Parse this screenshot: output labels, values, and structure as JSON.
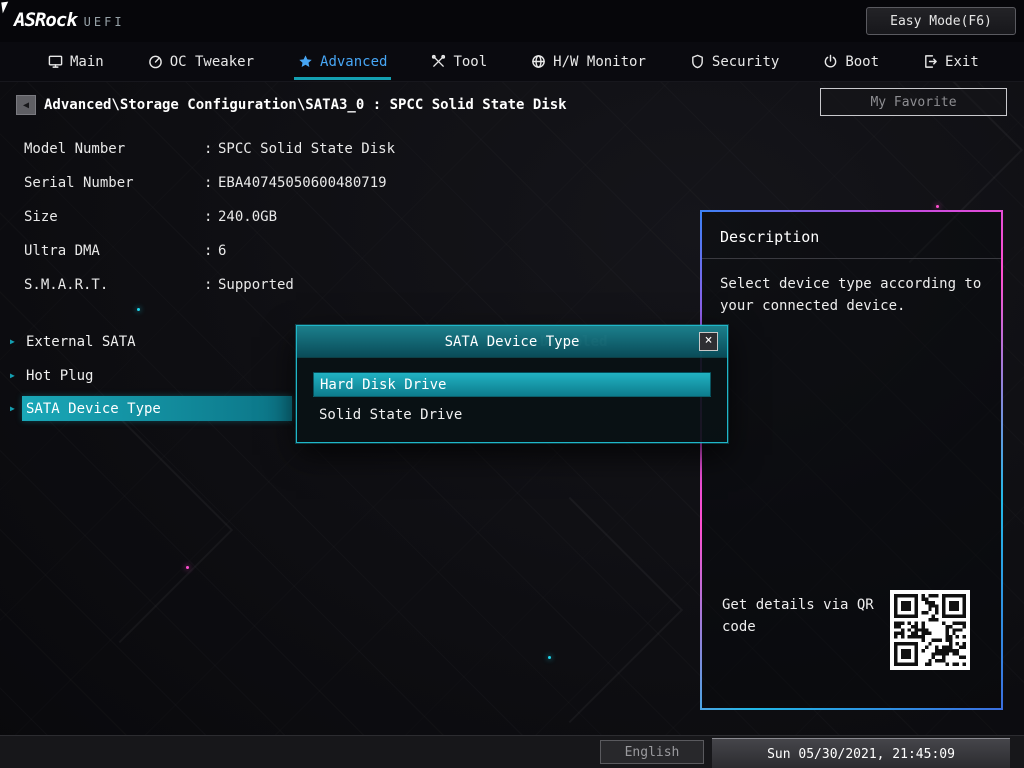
{
  "icons": {
    "back": "◀",
    "close": "×",
    "marker": "▶"
  },
  "topbar": {
    "brand": "ASRock",
    "brand_suffix": "UEFI",
    "easy_mode_button": "Easy Mode(F6)"
  },
  "nav": {
    "tabs": [
      {
        "label": "Main",
        "icon": "monitor-icon",
        "active": false
      },
      {
        "label": "OC Tweaker",
        "icon": "gauge-icon",
        "active": false
      },
      {
        "label": "Advanced",
        "icon": "star-icon",
        "active": true
      },
      {
        "label": "Tool",
        "icon": "tools-icon",
        "active": false
      },
      {
        "label": "H/W Monitor",
        "icon": "globe-icon",
        "active": false
      },
      {
        "label": "Security",
        "icon": "shield-icon",
        "active": false
      },
      {
        "label": "Boot",
        "icon": "power-icon",
        "active": false
      },
      {
        "label": "Exit",
        "icon": "exit-icon",
        "active": false
      }
    ]
  },
  "breadcrumb": {
    "path": "Advanced\\Storage Configuration\\SATA3_0 : SPCC Solid State Disk"
  },
  "my_favorite_button": "My Favorite",
  "punct": {
    "colon": ":"
  },
  "device_info": [
    {
      "label": "Model Number",
      "value": "SPCC Solid State Disk"
    },
    {
      "label": "Serial Number",
      "value": "EBA40745050600480719"
    },
    {
      "label": "Size",
      "value": "240.0GB"
    },
    {
      "label": "Ultra DMA",
      "value": "6"
    },
    {
      "label": "S.M.A.R.T.",
      "value": "Supported"
    }
  ],
  "settings": [
    {
      "label": "External SATA",
      "value": "Disabled",
      "selected": false
    },
    {
      "label": "Hot Plug",
      "selected": false
    },
    {
      "label": "SATA Device Type",
      "selected": true
    }
  ],
  "dialog": {
    "title": "SATA Device Type",
    "options": [
      {
        "label": "Hard Disk Drive",
        "selected": true
      },
      {
        "label": "Solid State Drive",
        "selected": false
      }
    ]
  },
  "description": {
    "title": "Description",
    "body": "Select device type according to your connected device.",
    "qr_caption": "Get details via QR code"
  },
  "footer": {
    "language_button": "English",
    "datetime": "Sun 05/30/2021, 21:45:09"
  },
  "colors": {
    "accent_teal": "#14a0b2",
    "accent_blue": "#47a6f5",
    "accent_pink": "#e84fd4"
  }
}
